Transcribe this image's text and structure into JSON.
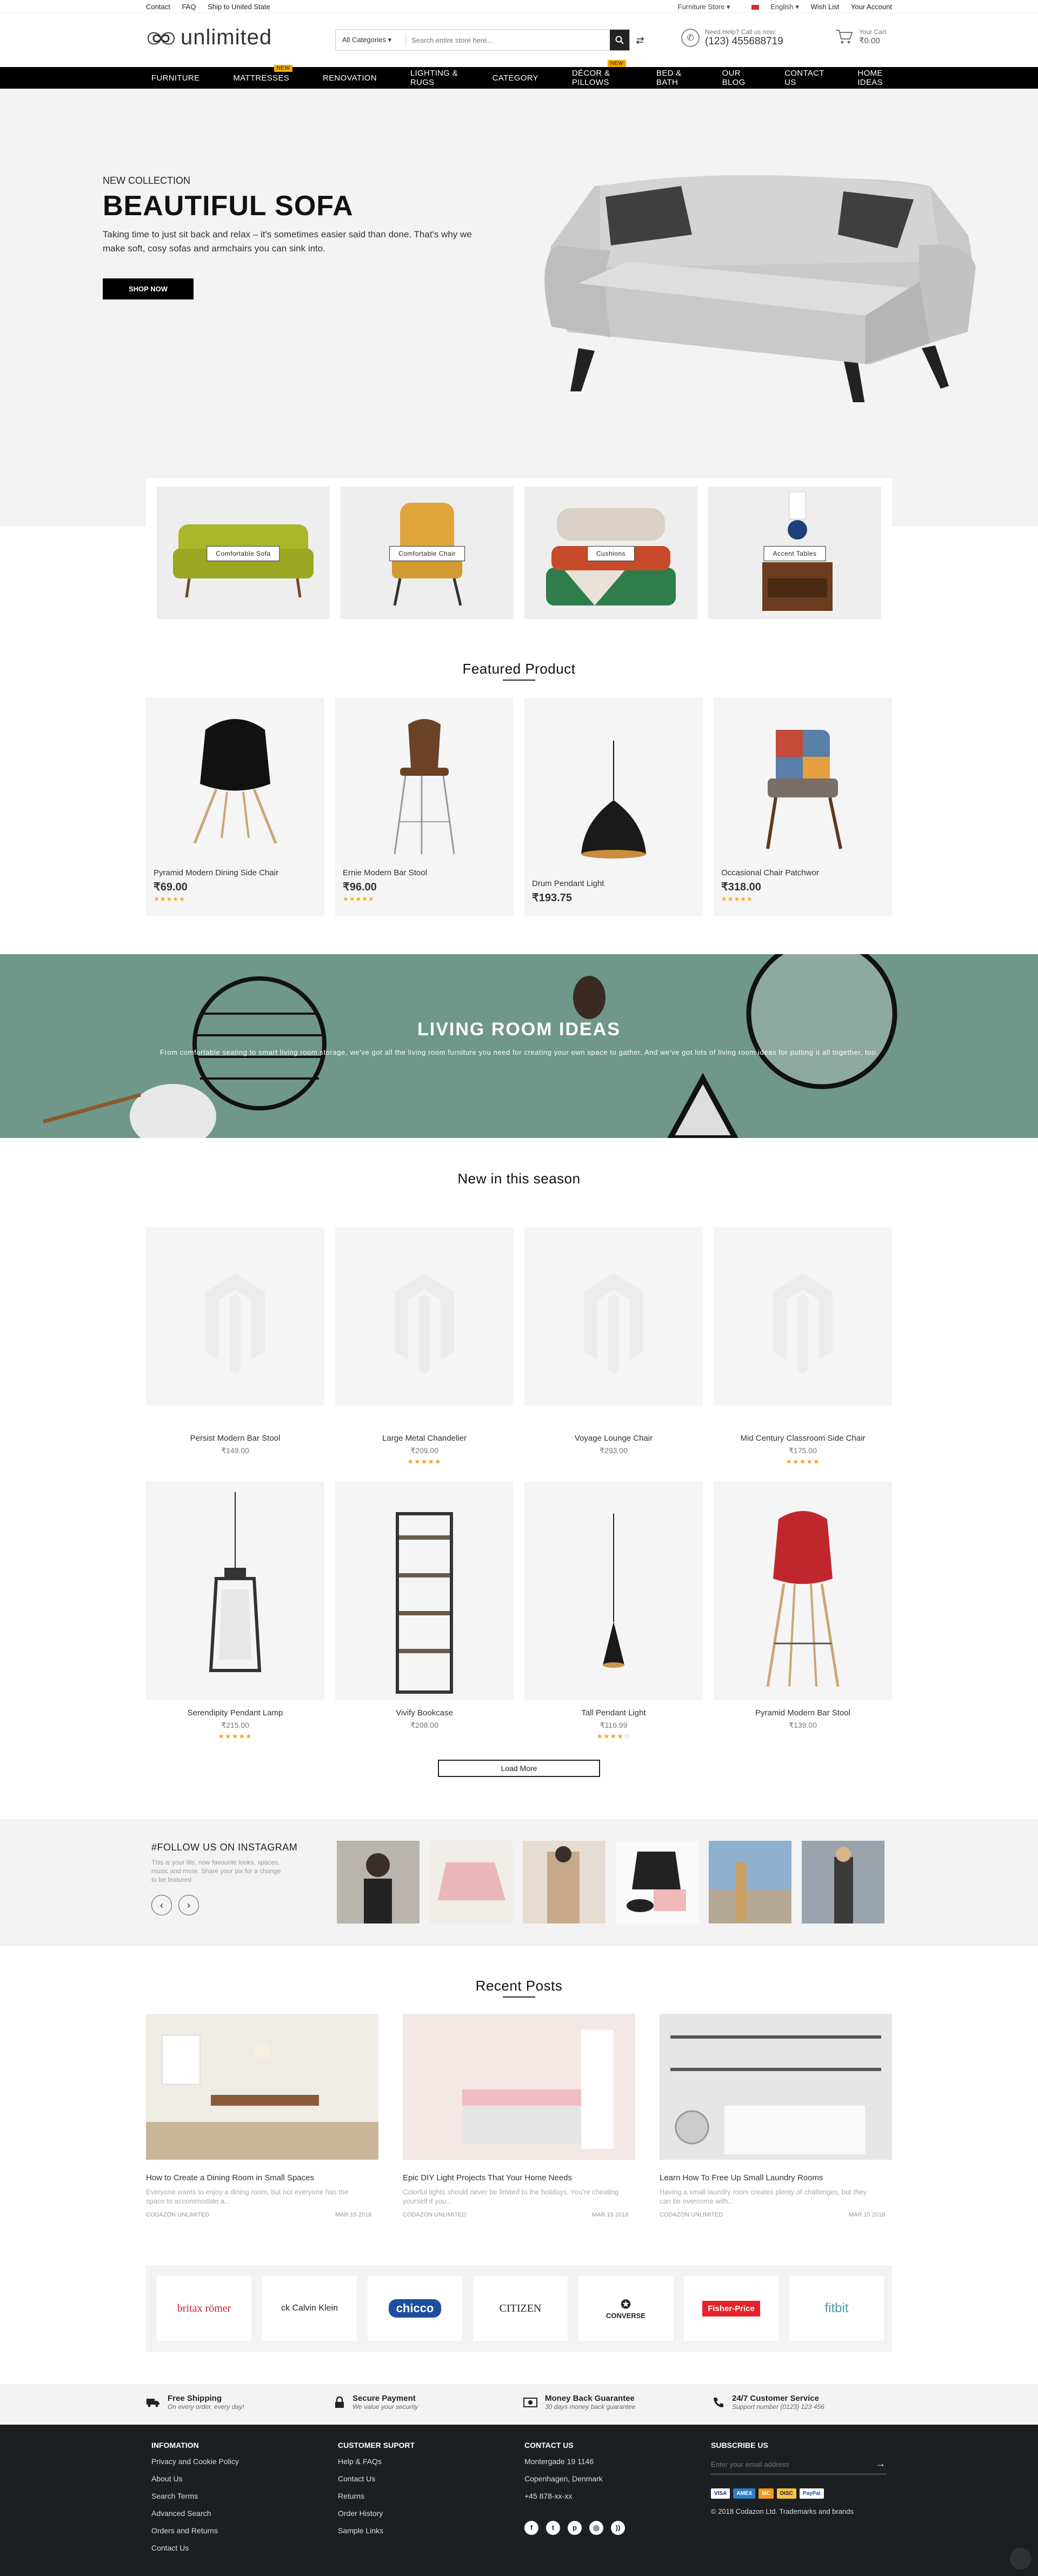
{
  "topbar": {
    "links": [
      "Contact",
      "FAQ",
      "Ship to United State"
    ],
    "store": "Furniture Store",
    "language": "English",
    "wishlist": "Wish List",
    "account": "Your Account"
  },
  "header": {
    "logo": "unlimited",
    "search_category": "All Categories",
    "search_placeholder": "Search entire store here...",
    "help_label": "Need Help? Call us now:",
    "phone": "(123) 455688719",
    "cart_label": "Your Cart",
    "cart_total": "₹0.00"
  },
  "nav": [
    {
      "label": "FURNITURE"
    },
    {
      "label": "MATTRESSES",
      "badge": "NEW"
    },
    {
      "label": "RENOVATION"
    },
    {
      "label": "LIGHTING & RUGS"
    },
    {
      "label": "CATEGORY"
    },
    {
      "label": "DÉCOR & PILLOWS",
      "badge": "NEW"
    },
    {
      "label": "BED & BATH"
    },
    {
      "label": "OUR BLOG"
    },
    {
      "label": "CONTACT US"
    },
    {
      "label": "HOME IDEAS"
    }
  ],
  "hero": {
    "kicker": "NEW COLLECTION",
    "title": "BEAUTIFUL SOFA",
    "text": "Taking time to just sit back and relax – it's sometimes easier said than done. That's why we make soft, cosy sofas and armchairs you can sink into.",
    "button": "SHOP NOW"
  },
  "categories": [
    "Comfortable Sofa",
    "Comfortable Chair",
    "Cushions",
    "Accent Tables"
  ],
  "featured": {
    "title": "Featured Product",
    "items": [
      {
        "name": "Pyramid Modern Dining Side Chair",
        "price": "₹69.00",
        "stars": "★★★★★"
      },
      {
        "name": "Ernie Modern Bar Stool",
        "price": "₹96.00",
        "stars": "★★★★★"
      },
      {
        "name": "Drum Pendant Light",
        "price": "₹193.75",
        "stars": ""
      },
      {
        "name": "Occasional Chair Patchwor",
        "price": "₹318.00",
        "stars": "★★★★★"
      }
    ]
  },
  "banner": {
    "title": "LIVING ROOM IDEAS",
    "text": "From comfortable seating to smart living room storage, we've got all the living room furniture you need for creating your own space to gather. And we've got lots of living room ideas for putting it all together, too."
  },
  "new_season": {
    "title": "New in this season",
    "items": [
      {
        "name": "Persist Modern Bar Stool",
        "price": "₹149.00",
        "stars": ""
      },
      {
        "name": "Large Metal Chandelier",
        "price": "₹209.00",
        "stars": "★★★★★"
      },
      {
        "name": "Voyage Lounge Chair",
        "price": "₹293.00",
        "stars": ""
      },
      {
        "name": "Mid Century Classroom Side Chair",
        "price": "₹175.00",
        "stars": "★★★★★"
      },
      {
        "name": "Serendipity Pendant Lamp",
        "price": "₹215.00",
        "stars": "★★★★★"
      },
      {
        "name": "Vivify Bookcase",
        "price": "₹208.00",
        "stars": ""
      },
      {
        "name": "Tall Pendant Light",
        "price": "₹116.99",
        "stars": "★★★★☆"
      },
      {
        "name": "Pyramid Modern Bar Stool",
        "price": "₹139.00",
        "stars": ""
      }
    ],
    "load_more": "Load More"
  },
  "instagram": {
    "title": "#FOLLOW US ON INSTAGRAM",
    "text": "This is your life, now favourite looks, spaces, music and more. Share your pix for a change to be featured"
  },
  "posts": {
    "title": "Recent Posts",
    "items": [
      {
        "title": "How to Create a Dining Room in Small Spaces",
        "text": "Everyone wants to enjoy a dining room, but not everyone has the space to accommodate a...",
        "author": "CODAZON UNLIMITED",
        "date": "MAR 15 2018"
      },
      {
        "title": "Epic DIY Light Projects That Your Home Needs",
        "text": "Colorful lights should never be limited to the holidays. You're cheating yourself if you...",
        "author": "CODAZON UNLIMITED",
        "date": "MAR 15 2018"
      },
      {
        "title": "Learn How To Free Up Small Laundry Rooms",
        "text": "Having a small laundry room creates plenty of challenges, but they can be overcome with...",
        "author": "CODAZON UNLIMITED",
        "date": "MAR 15 2018"
      }
    ]
  },
  "brands": [
    "britax römer",
    "ck Calvin Klein",
    "chicco",
    "CITIZEN",
    "CONVERSE",
    "Fisher-Price",
    "fitbit"
  ],
  "services": [
    {
      "title": "Free Shipping",
      "sub": "On every order, every day!"
    },
    {
      "title": "Secure Payment",
      "sub": "We value your security"
    },
    {
      "title": "Money Back Guarantee",
      "sub": "30 days money back guarantee"
    },
    {
      "title": "24/7 Customer Service",
      "sub": "Support number (0123) 123 456"
    }
  ],
  "footer": {
    "info_title": "INFOMATION",
    "info": [
      "Privacy and Cookie Policy",
      "About Us",
      "Search Terms",
      "Advanced Search",
      "Orders and Returns",
      "Contact Us"
    ],
    "support_title": "CUSTOMER SUPORT",
    "support": [
      "Help & FAQs",
      "Contact Us",
      "Returns",
      "Order History",
      "Sample Links"
    ],
    "contact_title": "CONTACT US",
    "contact": [
      "Montergade 19 1146",
      "Copenhagen, Denmark",
      "+45 878-xx-xx"
    ],
    "subscribe_title": "SUBSCRIBE US",
    "email_placeholder": "Enter your email address",
    "payments": [
      "VISA",
      "AMEX",
      "MC",
      "DISC",
      "PayPal"
    ],
    "copyright": "© 2018 Codazon Ltd. Trademarks and brands"
  }
}
